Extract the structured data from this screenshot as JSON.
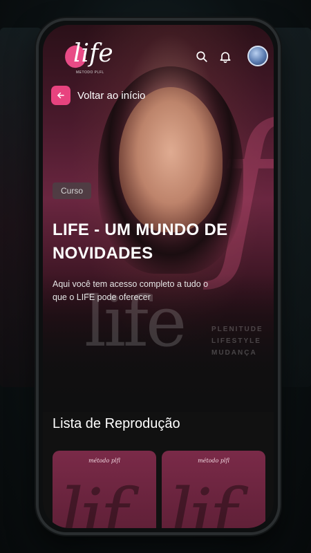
{
  "header": {
    "logo_text": "life",
    "logo_tagline": "METODO PLFL",
    "search_icon": "search-icon",
    "bell_icon": "bell-icon"
  },
  "navigation": {
    "back_label": "Voltar ao início",
    "back_icon": "arrow-left-icon"
  },
  "hero": {
    "badge": "Curso",
    "title": "LIFE - UM MUNDO DE NOVIDADES",
    "subtitle": "Aqui você tem acesso completo a tudo o que o LIFE pode oferecer",
    "watermark": "life",
    "watermark_words": [
      "PLENITUDE",
      "LIFESTYLE",
      "MUDANÇA"
    ]
  },
  "playlist": {
    "title": "Lista de Reprodução",
    "items": [
      {
        "brand": "método plfl",
        "big": "lif"
      },
      {
        "brand": "método plfl",
        "big": "lif"
      }
    ]
  },
  "colors": {
    "accent": "#e8437f",
    "background": "#0f0f10"
  }
}
